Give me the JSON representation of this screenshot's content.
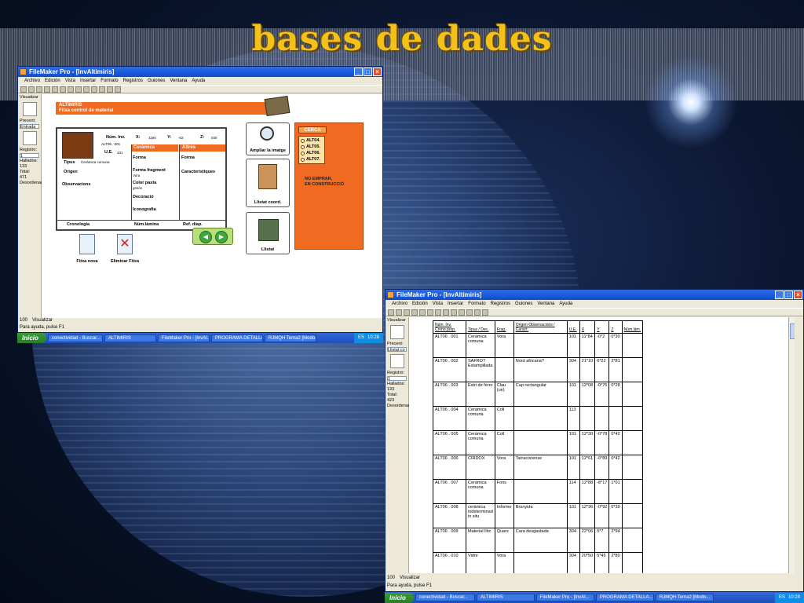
{
  "slide": {
    "title": "bases de dades"
  },
  "win1": {
    "title": "FileMaker Pro - [InvAltimiris]",
    "menu": [
      "Archivo",
      "Edición",
      "Vista",
      "Insertar",
      "Formato",
      "Registros",
      "Guiones",
      "Ventana",
      "Ayuda"
    ],
    "left": {
      "mode_label": "Visualizar",
      "precent_label": "Precent:",
      "precent_value": "Entrada",
      "registro_label": "Registro:",
      "registro_value": "1",
      "hallados_label": "Hallados:",
      "hallados_value": "133",
      "total_label": "Total:",
      "total_value": "471",
      "sort_label": "Desordenado"
    },
    "header": {
      "line1": "ALTIMIRIS",
      "line2": "Fitxa control de material"
    },
    "fields": {
      "num_inv": "Núm. Inv.",
      "num_inv_value": "ALT06 . 001",
      "ue": "U.E.",
      "ue_value": "101",
      "x_label": "X:",
      "x_value": "1194",
      "y_label": "Y:",
      "y_value": "-02",
      "z_label": "Z:",
      "z_value": "030",
      "tipus": "Tipus",
      "tipus_value": "Ceràmica comuna",
      "origen": "Origen",
      "observacions": "Observacions",
      "cronologia": "Cronologia",
      "num_lamina": "Núm.làmina",
      "ref_diap": "Ref. diap."
    },
    "ceramica": {
      "head": "Ceràmica",
      "forma": "Forma",
      "forma_fragment": "Forma fragment",
      "forma_fragment_value": "Vora",
      "color_pasta": "Color pasta",
      "color_pasta_value": "grisós",
      "decoracio": "Decoració",
      "iconografia": "Iconografia"
    },
    "altres": {
      "head": "Altres",
      "forma": "Forma",
      "caracteristiques": "Característiques"
    },
    "buttons": {
      "ampliar": "Ampliar la imatge",
      "llistat_coord": "Llistat coord.",
      "llistat": "Llistat",
      "fitxa_nova": "Fitxa nova",
      "eliminar_fitxa": "Eliminar Fitxa",
      "prev": "◀",
      "next": "▶"
    },
    "cerca": {
      "label": "CERCA",
      "options": [
        "ALT04.",
        "ALT05.",
        "ALT06.",
        "ALT07."
      ],
      "note_line1": "NO EMPRAR,",
      "note_line2": "EN CONSTRUCCIÓ"
    },
    "zoom": "100",
    "view": "Visualizar",
    "status": "Para ayuda, pulse F1"
  },
  "taskbar1": {
    "start": "Inicio",
    "tasks": [
      "conectividad - Buscar...",
      "ALTIMIRIS",
      "FileMaker Pro - [InvAl...",
      "PROGRAMA DETALLA...",
      "RJMQH Tema2 [Modo..."
    ],
    "lang": "ES",
    "clock": "10:28"
  },
  "win2": {
    "title": "FileMaker Pro - [InvAltimiris]",
    "menu": [
      "Archivo",
      "Edición",
      "Vista",
      "Insertar",
      "Formato",
      "Registros",
      "Guiones",
      "Ventana",
      "Ayuda"
    ],
    "left": {
      "mode_label": "Visualizar",
      "precent_label": "Precent:",
      "precent_value": "Llistat co",
      "registro_label": "Registro:",
      "registro_value": "1",
      "hallados_label": "Hallados:",
      "hallados_value": "133",
      "total_label": "Total:",
      "total_value": "423",
      "sort_label": "Desordenado"
    },
    "columns": [
      "Núm. Inv. Crono.prop.",
      "Tipus / Dec.",
      "Frag.",
      "Origen Observacions / Caract.",
      "U.E.",
      "X",
      "Y",
      "Z",
      "Núm.lám."
    ],
    "rows": [
      [
        "ALT06 . 001",
        "Ceràmica comuna",
        "Vora",
        "",
        "101",
        "11*84",
        "-0*2",
        "0*30",
        ""
      ],
      [
        "ALT06 . 002",
        "SAFRO? Estampillada",
        "",
        "Nord africana?",
        "304",
        "21*10",
        "6*22",
        "2*81",
        ""
      ],
      [
        "ALT06 . 003",
        "Estri de ferro",
        "Clau (un)",
        "Cap rectangular",
        "101",
        "12*08",
        "-0*76",
        "0*28",
        ""
      ],
      [
        "ALT06 . 004",
        "Ceràmica comuna",
        "Coll",
        "",
        "113",
        "",
        "",
        "",
        ""
      ],
      [
        "ALT06 . 005",
        "Ceràmica comuna",
        "Coll",
        "",
        "101",
        "12*30",
        "-0*78",
        "0*42",
        ""
      ],
      [
        "ALT06 . 006",
        "CIRDOX",
        "Vora",
        "Tarraconense",
        "101",
        "12*61",
        "-0*89",
        "0*42",
        ""
      ],
      [
        "ALT06 . 007",
        "Ceràmica comuna",
        "Fons",
        "",
        "114",
        "12*88",
        "-8*17",
        "1*01",
        ""
      ],
      [
        "ALT06 . 008",
        "ceràmica indeterminad in situ",
        "Informe",
        "Brunyida",
        "101",
        "12*36",
        "-0*92",
        "0*39",
        ""
      ],
      [
        "ALT06 . 009",
        "Material lític",
        "Quars",
        "Cara desgastada",
        "304",
        "22*06",
        "5*7",
        "2*94",
        ""
      ],
      [
        "ALT06 . 010",
        "Vidre",
        "Vora",
        "",
        "304",
        "20*50",
        "5*45",
        "2*80",
        ""
      ]
    ],
    "zoom": "100",
    "view": "Visualizar",
    "status": "Para ayuda, pulse F1"
  },
  "taskbar2": {
    "start": "Inicio",
    "tasks": [
      "conectividad - Buscar...",
      "ALTIMIRIS",
      "FileMaker Pro - [InvAl...",
      "PROGRAMA DETALLA...",
      "RJMQH Tema2 [Modo..."
    ],
    "lang": "ES",
    "clock": "10:28"
  }
}
